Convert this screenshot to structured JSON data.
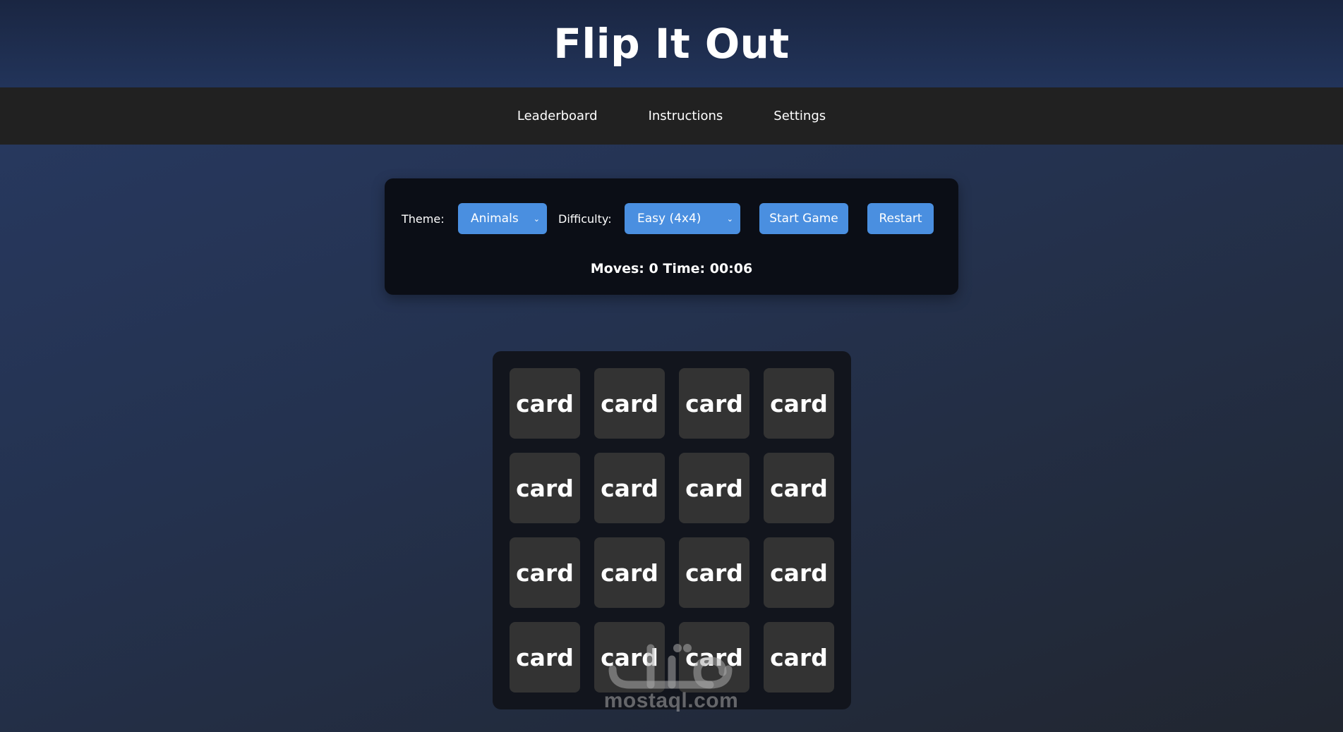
{
  "header": {
    "title": "Flip It Out"
  },
  "nav": {
    "items": [
      {
        "label": "Leaderboard"
      },
      {
        "label": "Instructions"
      },
      {
        "label": "Settings"
      }
    ]
  },
  "controls": {
    "theme_label": "Theme:",
    "theme_value": "Animals",
    "difficulty_label": "Difficulty:",
    "difficulty_value": "Easy (4x4)",
    "start_label": "Start Game",
    "restart_label": "Restart",
    "stats_text": "Moves: 0 Time: 00:06"
  },
  "board": {
    "card_label": "card",
    "rows": 4,
    "columns": 4
  },
  "watermark": {
    "text": "mostaql.com"
  },
  "colors": {
    "accent": "#4a8fe0",
    "card": "#333333",
    "panel": "#0b0e16",
    "nav": "#212121"
  }
}
